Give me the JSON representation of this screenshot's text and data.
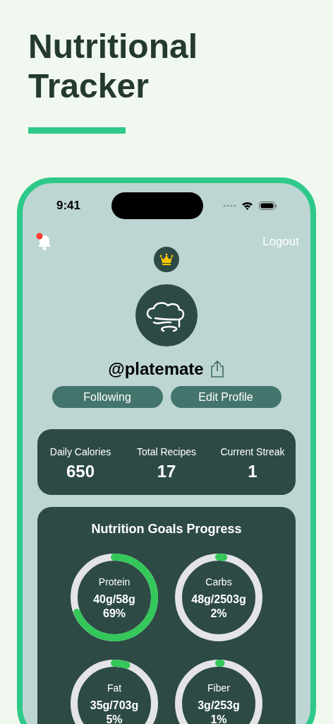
{
  "headline": "Nutritional Tracker",
  "status_bar": {
    "time": "9:41"
  },
  "header": {
    "notification_badge": true,
    "logout": "Logout"
  },
  "profile": {
    "premium": true,
    "username": "@platemate",
    "buttons": [
      "Following",
      "Edit Profile"
    ]
  },
  "stats": [
    {
      "label": "Daily Calories",
      "value": "650"
    },
    {
      "label": "Total Recipes",
      "value": "17"
    },
    {
      "label": "Current Streak",
      "value": "1"
    }
  ],
  "goals": {
    "title": "Nutrition Goals Progress",
    "items": [
      {
        "name": "Protein",
        "amount": "40g/58g",
        "percent": "69%",
        "level": 0.69
      },
      {
        "name": "Carbs",
        "amount": "48g/2503g",
        "percent": "2%",
        "level": 0.02
      },
      {
        "name": "Fat",
        "amount": "35g/703g",
        "percent": "5%",
        "level": 0.05
      },
      {
        "name": "Fiber",
        "amount": "3g/253g",
        "percent": "1%",
        "level": 0.01
      }
    ]
  }
}
